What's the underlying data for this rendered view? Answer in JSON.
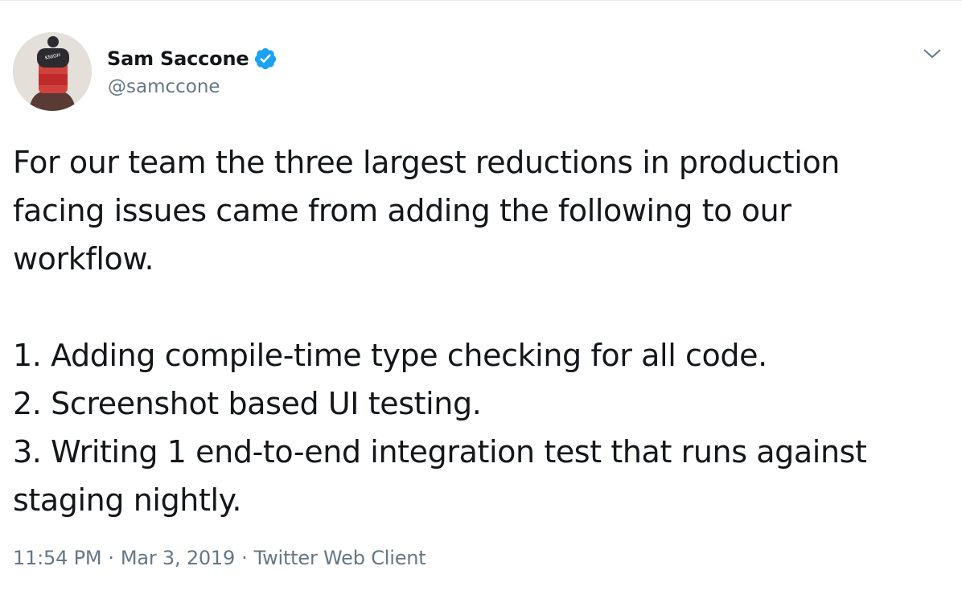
{
  "author": {
    "display_name": "Sam Saccone",
    "handle": "@samccone",
    "verified": true,
    "avatar_icon": "avatar-photo",
    "verified_icon": "verified-badge-icon"
  },
  "menu": {
    "icon": "chevron-down-icon"
  },
  "tweet": {
    "lines_para1": [
      "For our team the three largest reductions in production",
      "facing issues came from adding the following to our",
      "workflow."
    ],
    "lines_para2": [
      "1. Adding compile-time type checking for all code.",
      "2. Screenshot based UI testing.",
      "3. Writing 1 end-to-end integration test that runs against",
      "staging nightly."
    ]
  },
  "meta": {
    "time": "11:54 PM",
    "separator": "·",
    "date": "Mar 3, 2019",
    "client": "Twitter Web Client"
  },
  "colors": {
    "text": "#14171a",
    "secondary": "#657786",
    "verified": "#1da1f2"
  }
}
